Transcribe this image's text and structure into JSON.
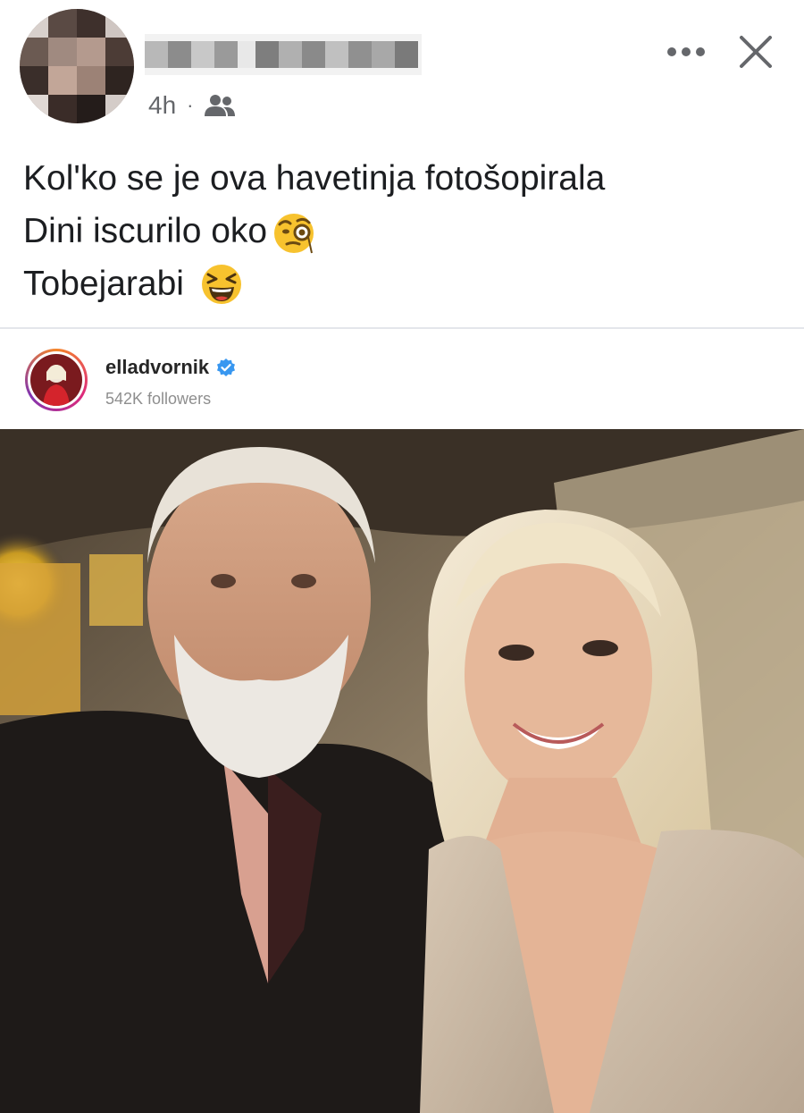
{
  "post": {
    "author_name": "",
    "time": "4h",
    "separator": "·",
    "audience_icon": "friends-icon",
    "more_icon": "more-icon",
    "close_icon": "close-icon",
    "lines": [
      {
        "text": "Kol'ko se je ova havetinja fotošopirala",
        "emoji": null
      },
      {
        "text": "Dini iscurilo oko",
        "emoji": "monocle-face-emoji"
      },
      {
        "text": "Tobejarabi",
        "emoji": "laughing-face-emoji"
      }
    ]
  },
  "embed": {
    "username": "elladvornik",
    "verified_icon": "verified-badge-icon",
    "followers": "542K followers",
    "accent_color": "#3897f0"
  },
  "colors": {
    "text": "#1c1e21",
    "secondary": "#65676b",
    "divider": "#e4e6eb"
  }
}
